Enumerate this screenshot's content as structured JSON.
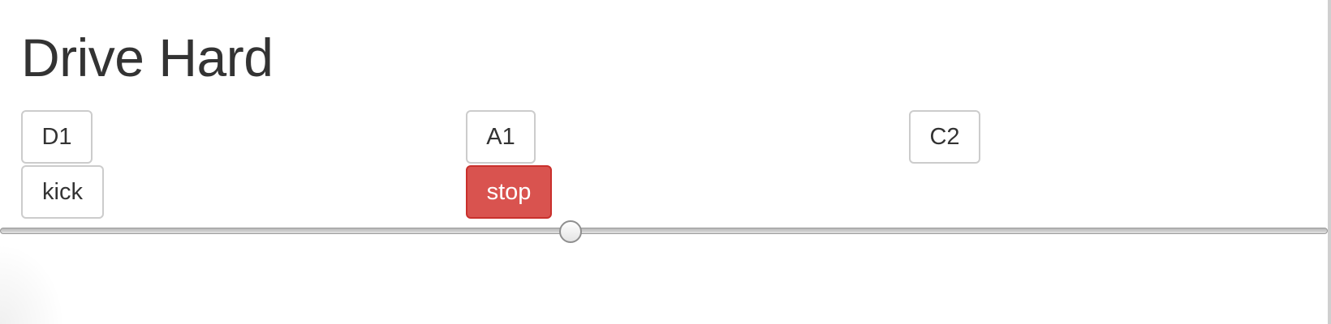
{
  "page": {
    "title": "Drive Hard"
  },
  "buttons": {
    "d1": "D1",
    "a1": "A1",
    "c2": "C2",
    "kick": "kick",
    "stop": "stop"
  },
  "colors": {
    "danger": "#d9534f",
    "text": "#333333",
    "border": "#cccccc"
  },
  "slider": {
    "value_fraction": 0.43
  }
}
